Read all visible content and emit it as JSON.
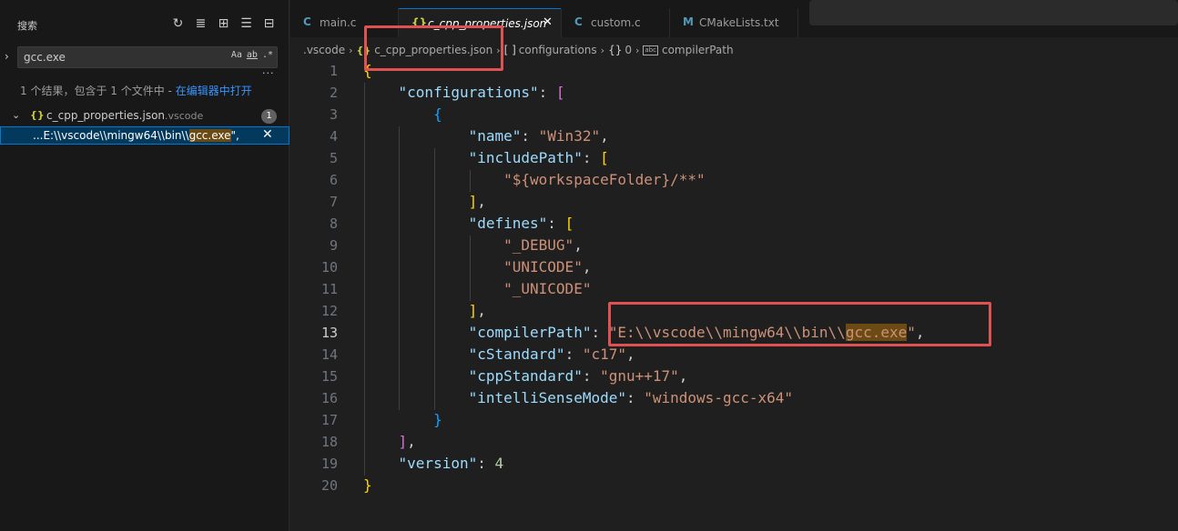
{
  "sidebar": {
    "title": "搜索",
    "actions": [
      {
        "name": "refresh-icon",
        "glyph": "↻"
      },
      {
        "name": "clear-results-icon",
        "glyph": "≣"
      },
      {
        "name": "new-search-editor-icon",
        "glyph": "⊞"
      },
      {
        "name": "view-as-list-icon",
        "glyph": "☰"
      },
      {
        "name": "collapse-all-icon",
        "glyph": "⊟"
      }
    ],
    "search_value": "gcc.exe",
    "search_options": [
      "Aa",
      "ab",
      ".*"
    ],
    "more": "···",
    "summary_text": "1 个结果，包含于 1 个文件中 - ",
    "summary_link": "在编辑器中打开",
    "file": {
      "icon": "{}",
      "name": "c_cpp_properties.json",
      "dir": ".vscode",
      "count": "1"
    },
    "match": {
      "prefix": "...E:\\\\vscode\\\\mingw64\\\\bin\\\\",
      "highlight": "gcc.exe",
      "suffix": "\","
    }
  },
  "tabs": [
    {
      "icon": "C",
      "label": "main.c",
      "active": false
    },
    {
      "icon": "{}",
      "label": "c_cpp_properties.json",
      "active": true,
      "close": "✕"
    },
    {
      "icon": "C",
      "label": "custom.c",
      "active": false
    },
    {
      "icon": "M",
      "label": "CMakeLists.txt",
      "active": false
    }
  ],
  "breadcrumb": {
    "folder": ".vscode",
    "file_icon": "{}",
    "file": "c_cpp_properties.json",
    "array_icon": "[ ]",
    "array": "configurations",
    "object_icon": "{}",
    "object": "0",
    "prop_icon": "abc",
    "prop": "compilerPath"
  },
  "editor": {
    "current_line": 13,
    "line_numbers": [
      "1",
      "2",
      "3",
      "4",
      "5",
      "6",
      "7",
      "8",
      "9",
      "10",
      "11",
      "12",
      "13",
      "14",
      "15",
      "16",
      "17",
      "18",
      "19",
      "20"
    ],
    "lines": [
      [
        {
          "t": "{",
          "c": "b1"
        }
      ],
      [
        {
          "t": "    ",
          "c": "p"
        },
        {
          "t": "\"configurations\"",
          "c": "k"
        },
        {
          "t": ": ",
          "c": "p"
        },
        {
          "t": "[",
          "c": "b2"
        }
      ],
      [
        {
          "t": "        ",
          "c": "p"
        },
        {
          "t": "{",
          "c": "b3"
        }
      ],
      [
        {
          "t": "            ",
          "c": "p"
        },
        {
          "t": "\"name\"",
          "c": "k"
        },
        {
          "t": ": ",
          "c": "p"
        },
        {
          "t": "\"Win32\"",
          "c": "s"
        },
        {
          "t": ",",
          "c": "p"
        }
      ],
      [
        {
          "t": "            ",
          "c": "p"
        },
        {
          "t": "\"includePath\"",
          "c": "k"
        },
        {
          "t": ": ",
          "c": "p"
        },
        {
          "t": "[",
          "c": "b1"
        }
      ],
      [
        {
          "t": "                ",
          "c": "p"
        },
        {
          "t": "\"${workspaceFolder}/**\"",
          "c": "s"
        }
      ],
      [
        {
          "t": "            ",
          "c": "p"
        },
        {
          "t": "]",
          "c": "b1"
        },
        {
          "t": ",",
          "c": "p"
        }
      ],
      [
        {
          "t": "            ",
          "c": "p"
        },
        {
          "t": "\"defines\"",
          "c": "k"
        },
        {
          "t": ": ",
          "c": "p"
        },
        {
          "t": "[",
          "c": "b1"
        }
      ],
      [
        {
          "t": "                ",
          "c": "p"
        },
        {
          "t": "\"_DEBUG\"",
          "c": "s"
        },
        {
          "t": ",",
          "c": "p"
        }
      ],
      [
        {
          "t": "                ",
          "c": "p"
        },
        {
          "t": "\"UNICODE\"",
          "c": "s"
        },
        {
          "t": ",",
          "c": "p"
        }
      ],
      [
        {
          "t": "                ",
          "c": "p"
        },
        {
          "t": "\"_UNICODE\"",
          "c": "s"
        }
      ],
      [
        {
          "t": "            ",
          "c": "p"
        },
        {
          "t": "]",
          "c": "b1"
        },
        {
          "t": ",",
          "c": "p"
        }
      ],
      [
        {
          "t": "            ",
          "c": "p"
        },
        {
          "t": "\"compilerPath\"",
          "c": "k"
        },
        {
          "t": ": ",
          "c": "p"
        },
        {
          "t": "\"E:\\\\vscode\\\\mingw64\\\\bin\\\\",
          "c": "s"
        },
        {
          "t": "gcc.exe",
          "c": "s hlm"
        },
        {
          "t": "\"",
          "c": "s"
        },
        {
          "t": ",",
          "c": "p"
        }
      ],
      [
        {
          "t": "            ",
          "c": "p"
        },
        {
          "t": "\"cStandard\"",
          "c": "k"
        },
        {
          "t": ": ",
          "c": "p"
        },
        {
          "t": "\"c17\"",
          "c": "s"
        },
        {
          "t": ",",
          "c": "p"
        }
      ],
      [
        {
          "t": "            ",
          "c": "p"
        },
        {
          "t": "\"cppStandard\"",
          "c": "k"
        },
        {
          "t": ": ",
          "c": "p"
        },
        {
          "t": "\"gnu++17\"",
          "c": "s"
        },
        {
          "t": ",",
          "c": "p"
        }
      ],
      [
        {
          "t": "            ",
          "c": "p"
        },
        {
          "t": "\"intelliSenseMode\"",
          "c": "k"
        },
        {
          "t": ": ",
          "c": "p"
        },
        {
          "t": "\"windows-gcc-x64\"",
          "c": "s"
        }
      ],
      [
        {
          "t": "        ",
          "c": "p"
        },
        {
          "t": "}",
          "c": "b3"
        }
      ],
      [
        {
          "t": "    ",
          "c": "p"
        },
        {
          "t": "]",
          "c": "b2"
        },
        {
          "t": ",",
          "c": "p"
        }
      ],
      [
        {
          "t": "    ",
          "c": "p"
        },
        {
          "t": "\"version\"",
          "c": "k"
        },
        {
          "t": ": ",
          "c": "p"
        },
        {
          "t": "4",
          "c": "n"
        }
      ],
      [
        {
          "t": "}",
          "c": "b1"
        }
      ]
    ]
  },
  "colors": {
    "annotation_red": "#e05252",
    "match_highlight": "#6b4a14",
    "accent_blue": "#0078d4"
  }
}
